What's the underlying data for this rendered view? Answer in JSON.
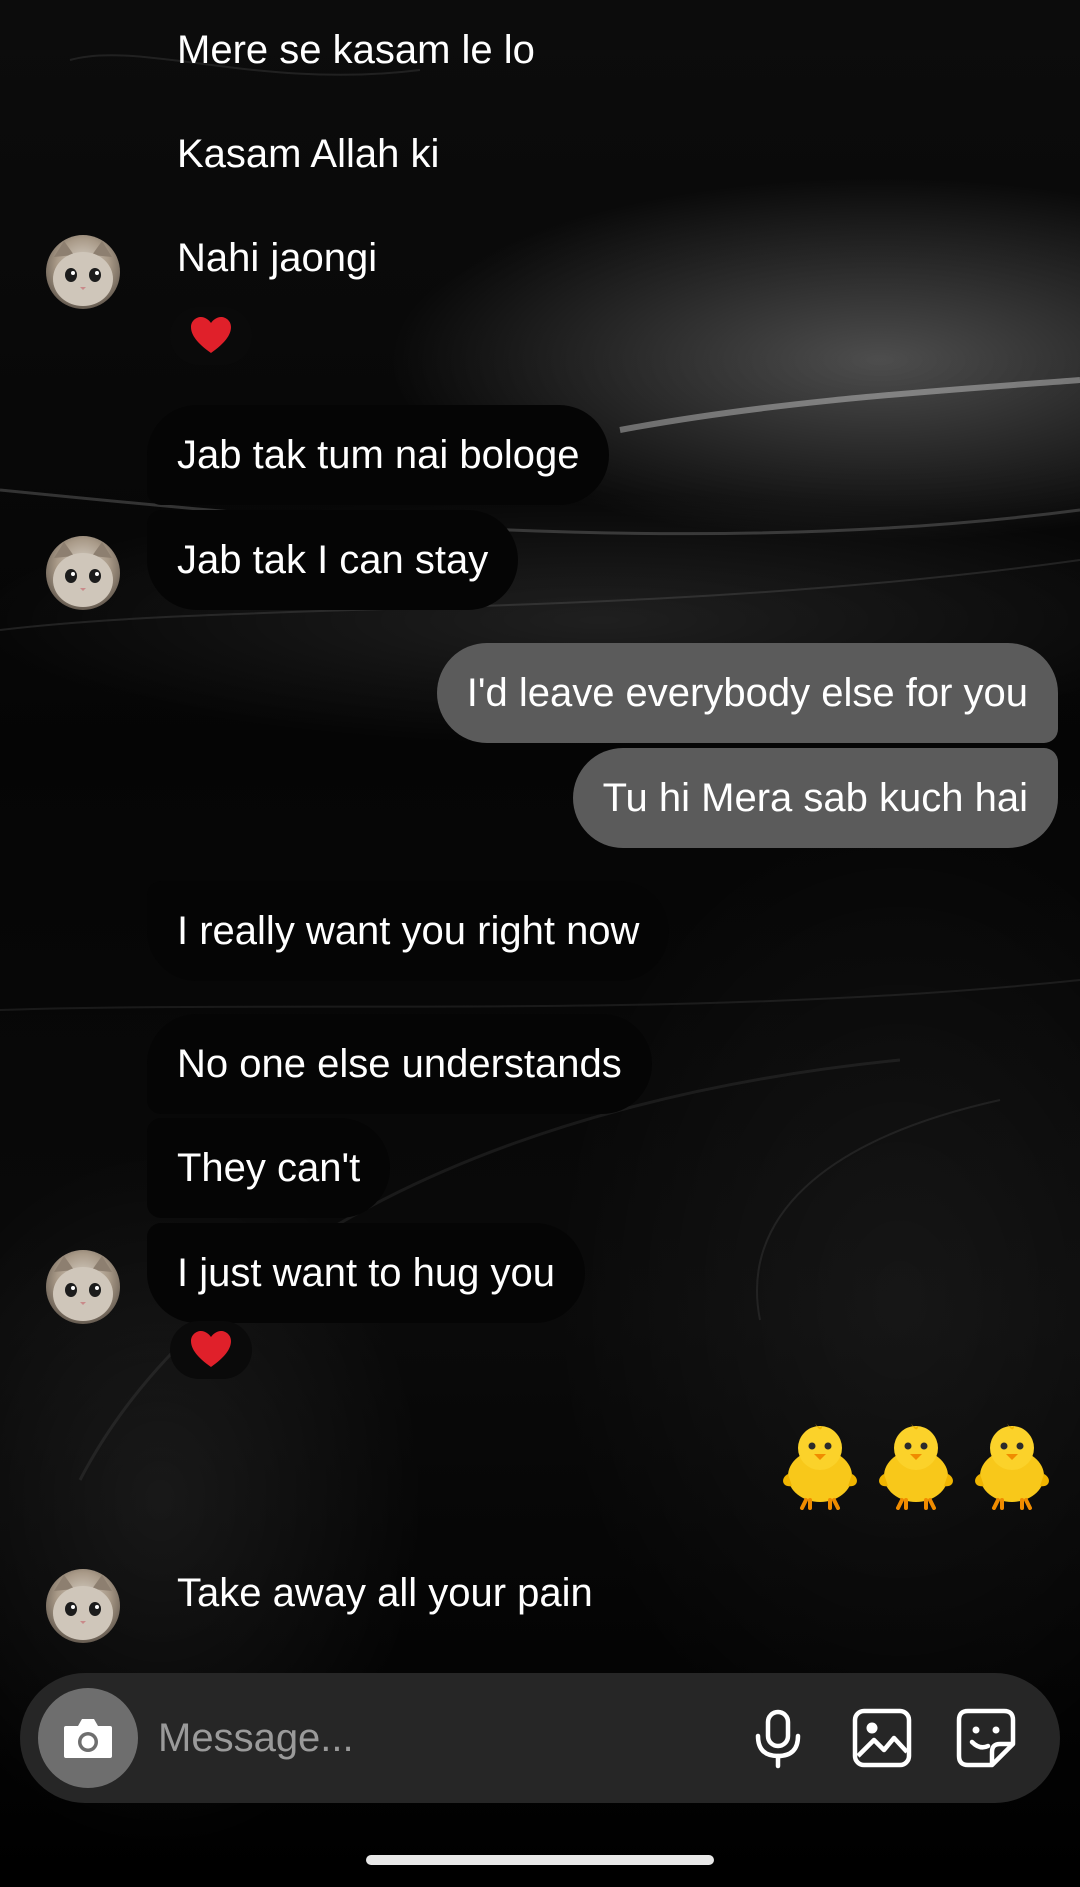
{
  "messages": {
    "m1": "Mere se kasam le lo",
    "m2": "Kasam Allah ki",
    "m3": "Nahi jaongi",
    "m4": "Jab tak tum nai bologe",
    "m5": "Jab tak I can stay",
    "m6": "I'd leave everybody else for you",
    "m7": "Tu hi Mera sab kuch hai",
    "m8": "I really want you right now",
    "m9": "No one else understands",
    "m10": "They can't",
    "m11": "I just want to hug you",
    "m12": "Take away all your pain"
  },
  "reactions": {
    "r1": "red-heart",
    "r2": "red-heart"
  },
  "sent_emoji": [
    "baby-chick",
    "baby-chick",
    "baby-chick"
  ],
  "composer": {
    "placeholder": "Message..."
  },
  "icons": {
    "camera": "camera-icon",
    "mic": "microphone-icon",
    "gallery": "image-icon",
    "sticker": "sticker-icon"
  },
  "colors": {
    "background": "#000000",
    "incoming_bubble": "#050505",
    "outgoing_bubble": "#5b5b5b",
    "composer_bg": "#262626",
    "camera_button": "#6e6e6e",
    "text": "#ffffff",
    "placeholder": "#9a9a9a"
  }
}
